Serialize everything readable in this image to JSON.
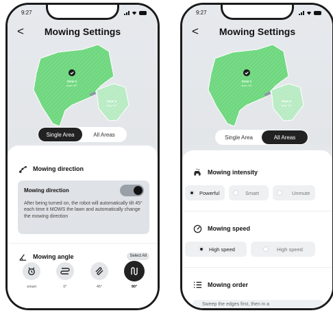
{
  "status": {
    "time": "9:27"
  },
  "colors": {
    "lawn": "#6fd77f",
    "lawn_light": "#b7ebc2",
    "dark": "#222222",
    "sheet": "#ffffff",
    "card": "#dfe2e6"
  },
  "phone1": {
    "title": "Mowing Settings",
    "back_label": "<",
    "map": {
      "zone1_name": "Zone 1",
      "zone1_sub": "Area / 40°",
      "zone2_name": "Zone 2",
      "zone2_sub": "Area / 45°"
    },
    "segment": {
      "single": "Single Area",
      "all": "All Areas",
      "selected": "Single Area"
    },
    "direction": {
      "title": "Mowing direction",
      "card_title": "Mowing direction",
      "toggle_on": true,
      "description": "After being turned on, the robot will automatically tilt 45° each time it MOWS the lawn and automatically change the mowing direction"
    },
    "angle": {
      "title": "Mowing angle",
      "select_all": "Select All",
      "options": [
        {
          "label": "smart",
          "icon": "robot-smart-icon"
        },
        {
          "label": "0°",
          "icon": "zigzag-0-icon"
        },
        {
          "label": "45°",
          "icon": "diagonal-45-icon"
        },
        {
          "label": "90°",
          "icon": "vertical-90-icon"
        }
      ],
      "selected": "90°"
    }
  },
  "phone2": {
    "title": "Mowing Settings",
    "back_label": "<",
    "map": {
      "zone1_name": "Zone 1",
      "zone1_sub": "Area / 40°",
      "zone2_name": "Zone 2",
      "zone2_sub": "Area / 45°"
    },
    "segment": {
      "single": "Single Area",
      "all": "All Areas",
      "selected": "All Areas"
    },
    "intensity": {
      "title": "Mowing intensity",
      "options": [
        "Powerful",
        "Smart",
        "Unmute"
      ],
      "selected": "Powerful"
    },
    "speed": {
      "title": "Mowing speed",
      "options": [
        "High speed",
        "High speed"
      ],
      "selected_index": 0
    },
    "order": {
      "title": "Mowing order",
      "first_option": "Sweep the edges first, then in a"
    }
  }
}
